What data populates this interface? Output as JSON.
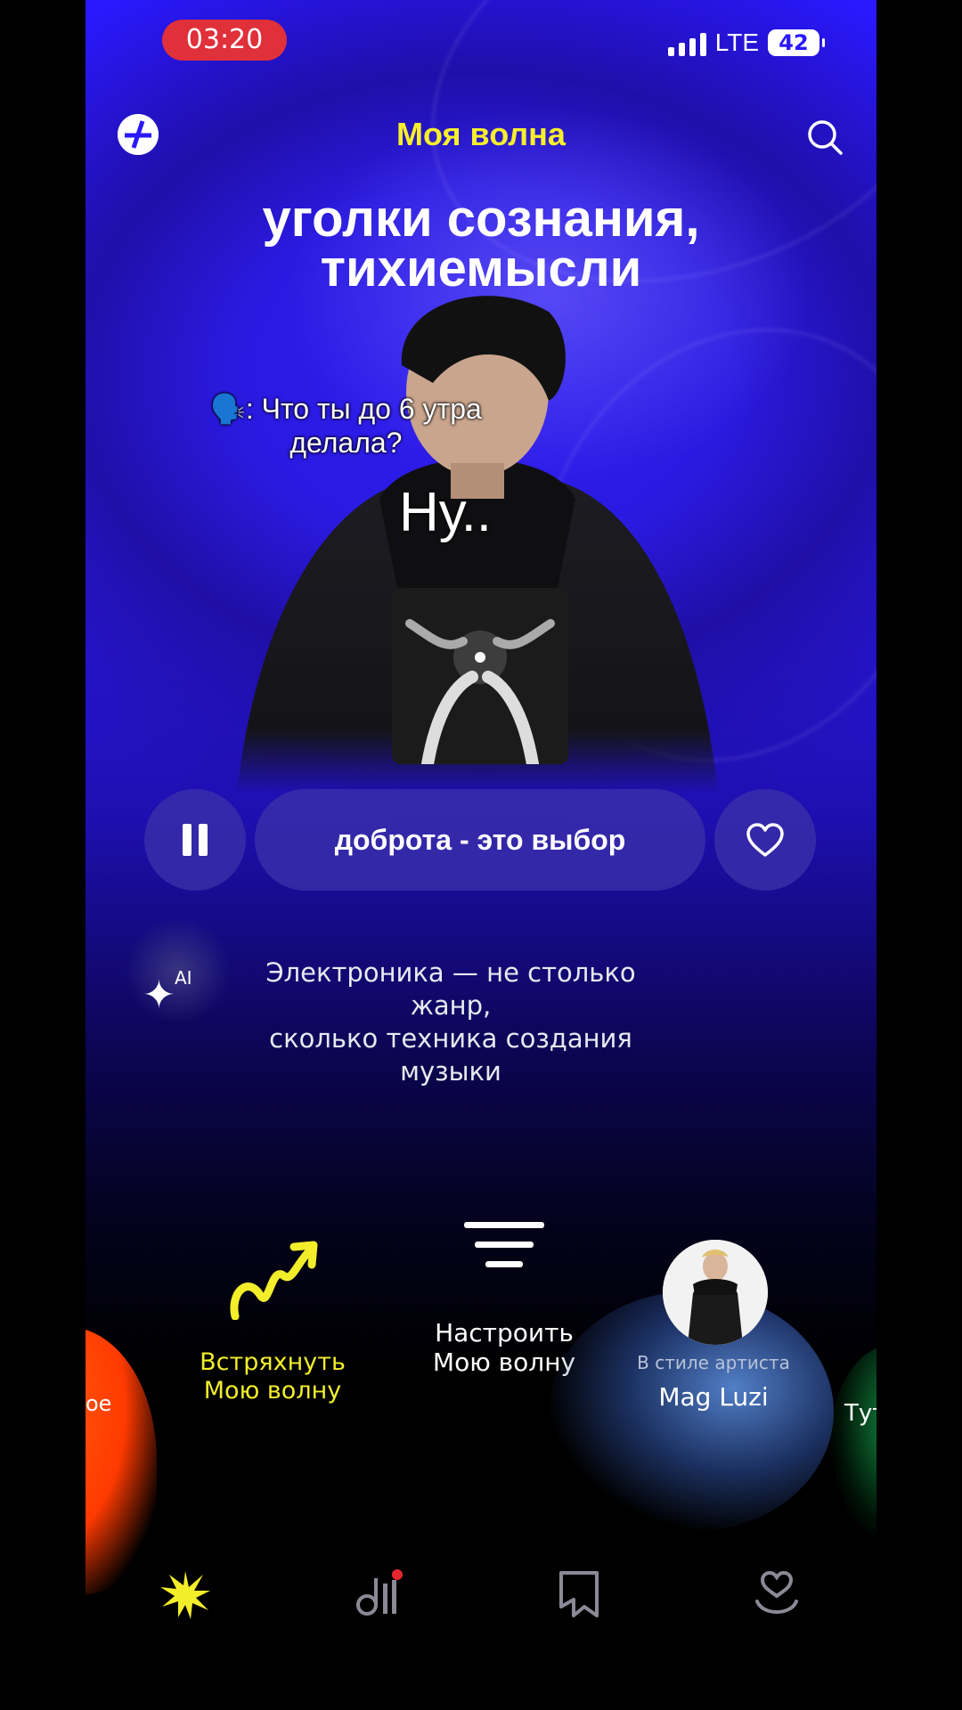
{
  "status_bar": {
    "time": "03:20",
    "network": "LTE",
    "battery": "42"
  },
  "header": {
    "title": "Моя волна"
  },
  "track": {
    "title_line1": "уголки сознания,",
    "title_line2": "тихиемысли"
  },
  "overlay": {
    "question_line1": "🗣️: Что ты до 6 утра",
    "question_line2": "делала?",
    "answer": "Ну.."
  },
  "player": {
    "song_label": "доброта - это выбор"
  },
  "ai": {
    "badge": "AI",
    "text_line1": "Электроника — не столько жанр,",
    "text_line2": "сколько техника создания музыки"
  },
  "actions": {
    "left_partial": "ое",
    "shake_line1": "Встряхнуть",
    "shake_line2": "Мою волну",
    "tune_line1": "Настроить",
    "tune_line2": "Мою волну",
    "artist_sub": "В стиле артиста",
    "artist_name": "Mag Luzi",
    "right_partial": "Тут"
  },
  "colors": {
    "accent": "#f7ef2a",
    "status_pill": "#e0303a",
    "background": "#2a18ff"
  },
  "tabs": [
    {
      "icon": "burst-icon",
      "active": true
    },
    {
      "icon": "equalizer-icon",
      "badge": true
    },
    {
      "icon": "bookmark-icon"
    },
    {
      "icon": "heart-user-icon"
    }
  ]
}
